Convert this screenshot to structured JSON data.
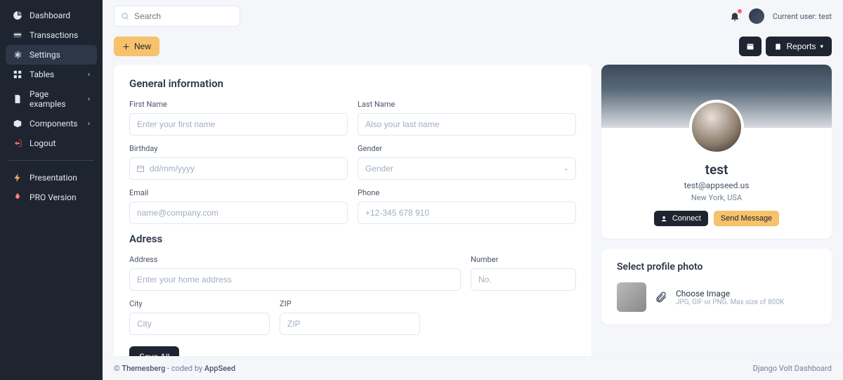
{
  "sidebar": {
    "items": [
      {
        "label": "Dashboard",
        "icon": "pie"
      },
      {
        "label": "Transactions",
        "icon": "card"
      },
      {
        "label": "Settings",
        "icon": "gear",
        "active": true
      },
      {
        "label": "Tables",
        "icon": "grid",
        "chev": true
      },
      {
        "label": "Page examples",
        "icon": "file",
        "chev": true
      },
      {
        "label": "Components",
        "icon": "box",
        "chev": true
      },
      {
        "label": "Logout",
        "icon": "logout"
      }
    ],
    "extra": [
      {
        "label": "Presentation",
        "icon": "bolt"
      },
      {
        "label": "PRO Version",
        "icon": "rocket"
      }
    ]
  },
  "topbar": {
    "search_placeholder": "Search",
    "current_user_label": "Current user: test"
  },
  "actions": {
    "new_label": "New",
    "reports_label": "Reports"
  },
  "form": {
    "section1_title": "General information",
    "first_name": {
      "label": "First Name",
      "placeholder": "Enter your first name"
    },
    "last_name": {
      "label": "Last Name",
      "placeholder": "Also your last name"
    },
    "birthday": {
      "label": "Birthday",
      "placeholder": "dd/mm/yyyy"
    },
    "gender": {
      "label": "Gender",
      "placeholder": "Gender"
    },
    "email": {
      "label": "Email",
      "placeholder": "name@company.com"
    },
    "phone": {
      "label": "Phone",
      "placeholder": "+12-345 678 910"
    },
    "section2_title": "Adress",
    "address": {
      "label": "Address",
      "placeholder": "Enter your home address"
    },
    "number": {
      "label": "Number",
      "placeholder": "No."
    },
    "city": {
      "label": "City",
      "placeholder": "City"
    },
    "zip": {
      "label": "ZIP",
      "placeholder": "ZIP"
    },
    "save_label": "Save All"
  },
  "profile": {
    "name": "test",
    "email": "test@appseed.us",
    "location": "New York, USA",
    "connect_label": "Connect",
    "message_label": "Send Message"
  },
  "photo": {
    "title": "Select profile photo",
    "choose_label": "Choose Image",
    "hint": "JPG, GIF or PNG. Max size of 800K"
  },
  "footer": {
    "copyright_prefix": "© ",
    "brand1": "Themesberg",
    "middle": " - coded by ",
    "brand2": "AppSeed",
    "right": "Django Volt Dashboard"
  }
}
